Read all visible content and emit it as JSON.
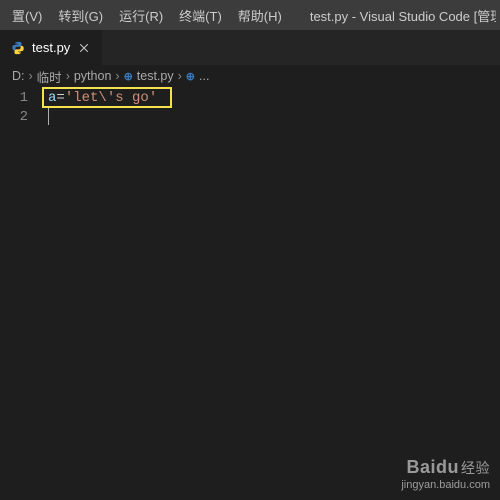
{
  "menubar": {
    "items": [
      "置(V)",
      "转到(G)",
      "运行(R)",
      "终端(T)",
      "帮助(H)"
    ]
  },
  "window": {
    "title": "test.py - Visual Studio Code [管理"
  },
  "tabs": {
    "active": {
      "icon": "python-file-icon",
      "label": "test.py"
    }
  },
  "breadcrumb": {
    "parts": [
      "D:",
      "临时",
      "python",
      "test.py",
      "..."
    ]
  },
  "editor": {
    "line_numbers": [
      "1",
      "2"
    ],
    "line1": {
      "var": "a",
      "op": "=",
      "str": "'let\\'s go'"
    }
  },
  "watermark": {
    "brand": "Baidu",
    "brand_sub": "经验",
    "url": "jingyan.baidu.com"
  }
}
